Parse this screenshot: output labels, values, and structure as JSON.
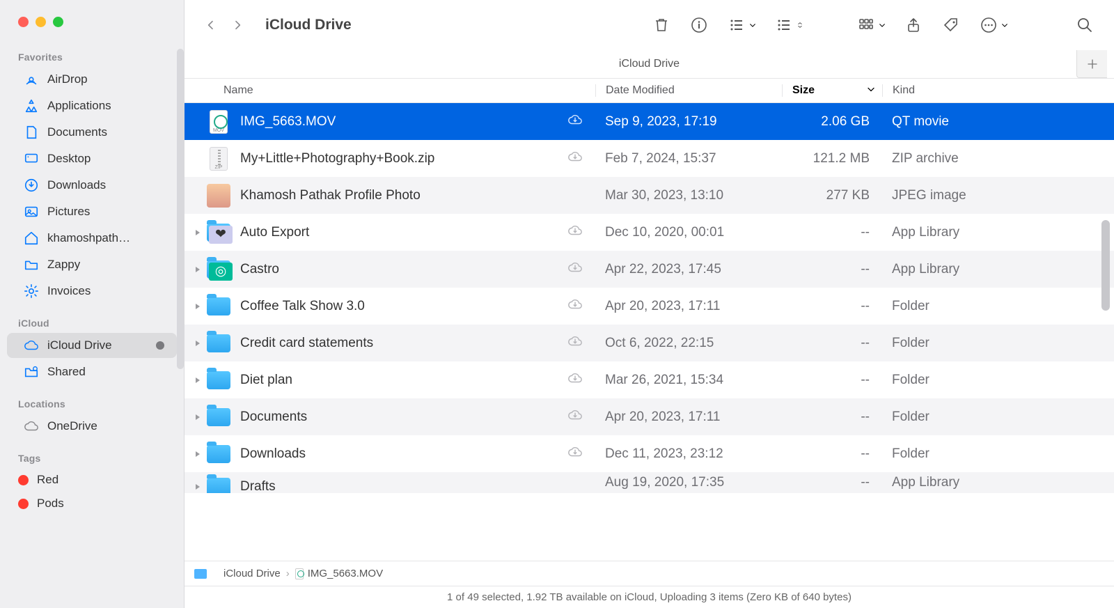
{
  "window": {
    "title": "iCloud Drive",
    "subtitle": "iCloud Drive"
  },
  "sidebar": {
    "sections": [
      {
        "label": "Favorites",
        "items": [
          {
            "label": "AirDrop",
            "icon": "airdrop"
          },
          {
            "label": "Applications",
            "icon": "applications"
          },
          {
            "label": "Documents",
            "icon": "documents"
          },
          {
            "label": "Desktop",
            "icon": "desktop"
          },
          {
            "label": "Downloads",
            "icon": "downloads"
          },
          {
            "label": "Pictures",
            "icon": "pictures"
          },
          {
            "label": "khamoshpath…",
            "icon": "home"
          },
          {
            "label": "Zappy",
            "icon": "folder"
          },
          {
            "label": "Invoices",
            "icon": "gear"
          }
        ]
      },
      {
        "label": "iCloud",
        "items": [
          {
            "label": "iCloud Drive",
            "icon": "cloud",
            "active": true,
            "dot": true
          },
          {
            "label": "Shared",
            "icon": "shared"
          }
        ]
      },
      {
        "label": "Locations",
        "items": [
          {
            "label": "OneDrive",
            "icon": "cloud-grey"
          }
        ]
      },
      {
        "label": "Tags",
        "tags": [
          {
            "label": "Red",
            "color": "red"
          },
          {
            "label": "Pods",
            "color": "red"
          }
        ]
      }
    ]
  },
  "columns": {
    "name": "Name",
    "modified": "Date Modified",
    "size": "Size",
    "kind": "Kind",
    "sort": "size"
  },
  "files": [
    {
      "name": "IMG_5663.MOV",
      "modified": "Sep 9, 2023, 17:19",
      "size": "2.06 GB",
      "kind": "QT movie",
      "icon": "qt",
      "cloud": true,
      "selected": true,
      "expandable": false
    },
    {
      "name": "My+Little+Photography+Book.zip",
      "modified": "Feb 7, 2024, 15:37",
      "size": "121.2 MB",
      "kind": "ZIP archive",
      "icon": "zip",
      "cloud": true,
      "expandable": false
    },
    {
      "name": "Khamosh Pathak Profile Photo",
      "modified": "Mar 30, 2023, 13:10",
      "size": "277 KB",
      "kind": "JPEG image",
      "icon": "avatar",
      "cloud": false,
      "expandable": false
    },
    {
      "name": "Auto Export",
      "modified": "Dec 10, 2020, 00:01",
      "size": "--",
      "kind": "App Library",
      "icon": "app-export",
      "cloud": true,
      "expandable": true
    },
    {
      "name": "Castro",
      "modified": "Apr 22, 2023, 17:45",
      "size": "--",
      "kind": "App Library",
      "icon": "app-castro",
      "cloud": true,
      "expandable": true
    },
    {
      "name": "Coffee Talk Show 3.0",
      "modified": "Apr 20, 2023, 17:11",
      "size": "--",
      "kind": "Folder",
      "icon": "folder",
      "cloud": true,
      "expandable": true
    },
    {
      "name": "Credit card statements",
      "modified": "Oct 6, 2022, 22:15",
      "size": "--",
      "kind": "Folder",
      "icon": "folder",
      "cloud": true,
      "expandable": true
    },
    {
      "name": "Diet plan",
      "modified": "Mar 26, 2021, 15:34",
      "size": "--",
      "kind": "Folder",
      "icon": "folder",
      "cloud": true,
      "expandable": true
    },
    {
      "name": "Documents",
      "modified": "Apr 20, 2023, 17:11",
      "size": "--",
      "kind": "Folder",
      "icon": "folder",
      "cloud": true,
      "expandable": true
    },
    {
      "name": "Downloads",
      "modified": "Dec 11, 2023, 23:12",
      "size": "--",
      "kind": "Folder",
      "icon": "folder",
      "cloud": true,
      "expandable": true
    },
    {
      "name": "Drafts",
      "modified": "Aug 19, 2020, 17:35",
      "size": "--",
      "kind": "App Library",
      "icon": "folder",
      "cloud": false,
      "expandable": true
    }
  ],
  "pathbar": {
    "crumb1": "iCloud Drive",
    "crumb2": "IMG_5663.MOV"
  },
  "status": "1 of 49 selected, 1.92 TB available on iCloud, Uploading 3 items (Zero KB of 640 bytes)"
}
